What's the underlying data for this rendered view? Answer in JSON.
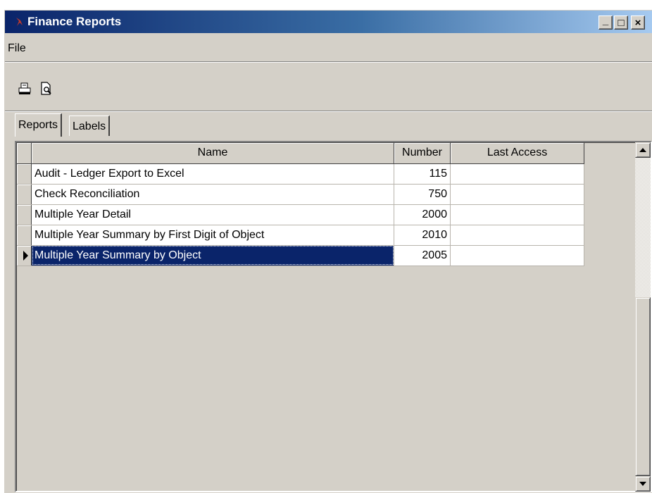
{
  "window": {
    "title": "Finance Reports",
    "minimize": "_",
    "maximize": "□",
    "close": "×"
  },
  "menu": {
    "file": "File"
  },
  "toolbar": {
    "print_icon": "printer-icon",
    "preview_icon": "print-preview-icon"
  },
  "tabs": [
    {
      "label": "Reports",
      "active": true
    },
    {
      "label": "Labels",
      "active": false
    }
  ],
  "grid": {
    "columns": {
      "name": "Name",
      "number": "Number",
      "last_access": "Last Access"
    },
    "rows": [
      {
        "name": "Audit - Ledger Export to Excel",
        "number": "115",
        "last_access": ""
      },
      {
        "name": "Check Reconciliation",
        "number": "750",
        "last_access": ""
      },
      {
        "name": "Multiple Year Detail",
        "number": "2000",
        "last_access": ""
      },
      {
        "name": "Multiple Year Summary by First Digit of Object",
        "number": "2010",
        "last_access": ""
      },
      {
        "name": "Multiple Year Summary by Object",
        "number": "2005",
        "last_access": "",
        "selected": true
      }
    ]
  },
  "colors": {
    "title_start": "#0a246a",
    "title_end": "#a6caf0",
    "selection": "#0a246a",
    "face": "#d4d0c8"
  }
}
